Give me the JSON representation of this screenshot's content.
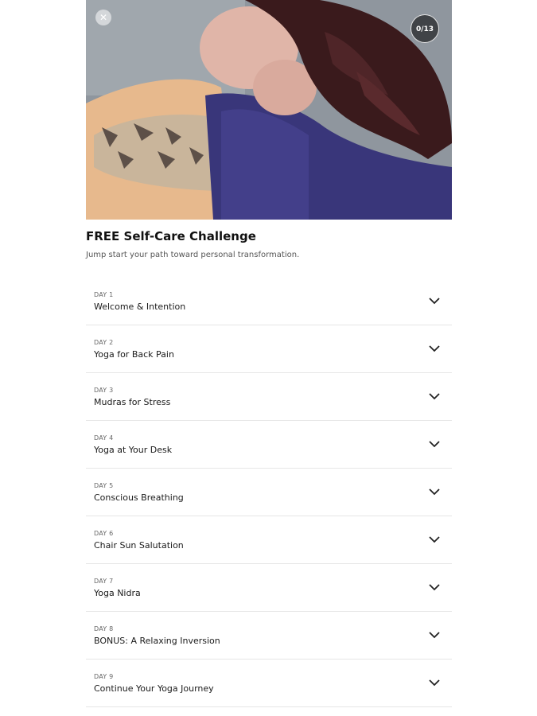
{
  "hero": {
    "close_icon": "close-icon",
    "progress_text": "0/13"
  },
  "challenge": {
    "title": "FREE Self-Care Challenge",
    "subtitle": "Jump start your path toward personal transformation."
  },
  "days": [
    {
      "label": "DAY 1",
      "name": "Welcome & Intention"
    },
    {
      "label": "DAY 2",
      "name": "Yoga for Back Pain"
    },
    {
      "label": "DAY 3",
      "name": "Mudras for Stress"
    },
    {
      "label": "DAY 4",
      "name": "Yoga at Your Desk"
    },
    {
      "label": "DAY 5",
      "name": "Conscious Breathing"
    },
    {
      "label": "DAY 6",
      "name": "Chair Sun Salutation"
    },
    {
      "label": "DAY 7",
      "name": "Yoga Nidra"
    },
    {
      "label": "DAY 8",
      "name": "BONUS: A Relaxing Inversion"
    },
    {
      "label": "DAY 9",
      "name": "Continue Your Yoga Journey"
    }
  ],
  "icons": {
    "expand": "chevron-down-icon"
  }
}
